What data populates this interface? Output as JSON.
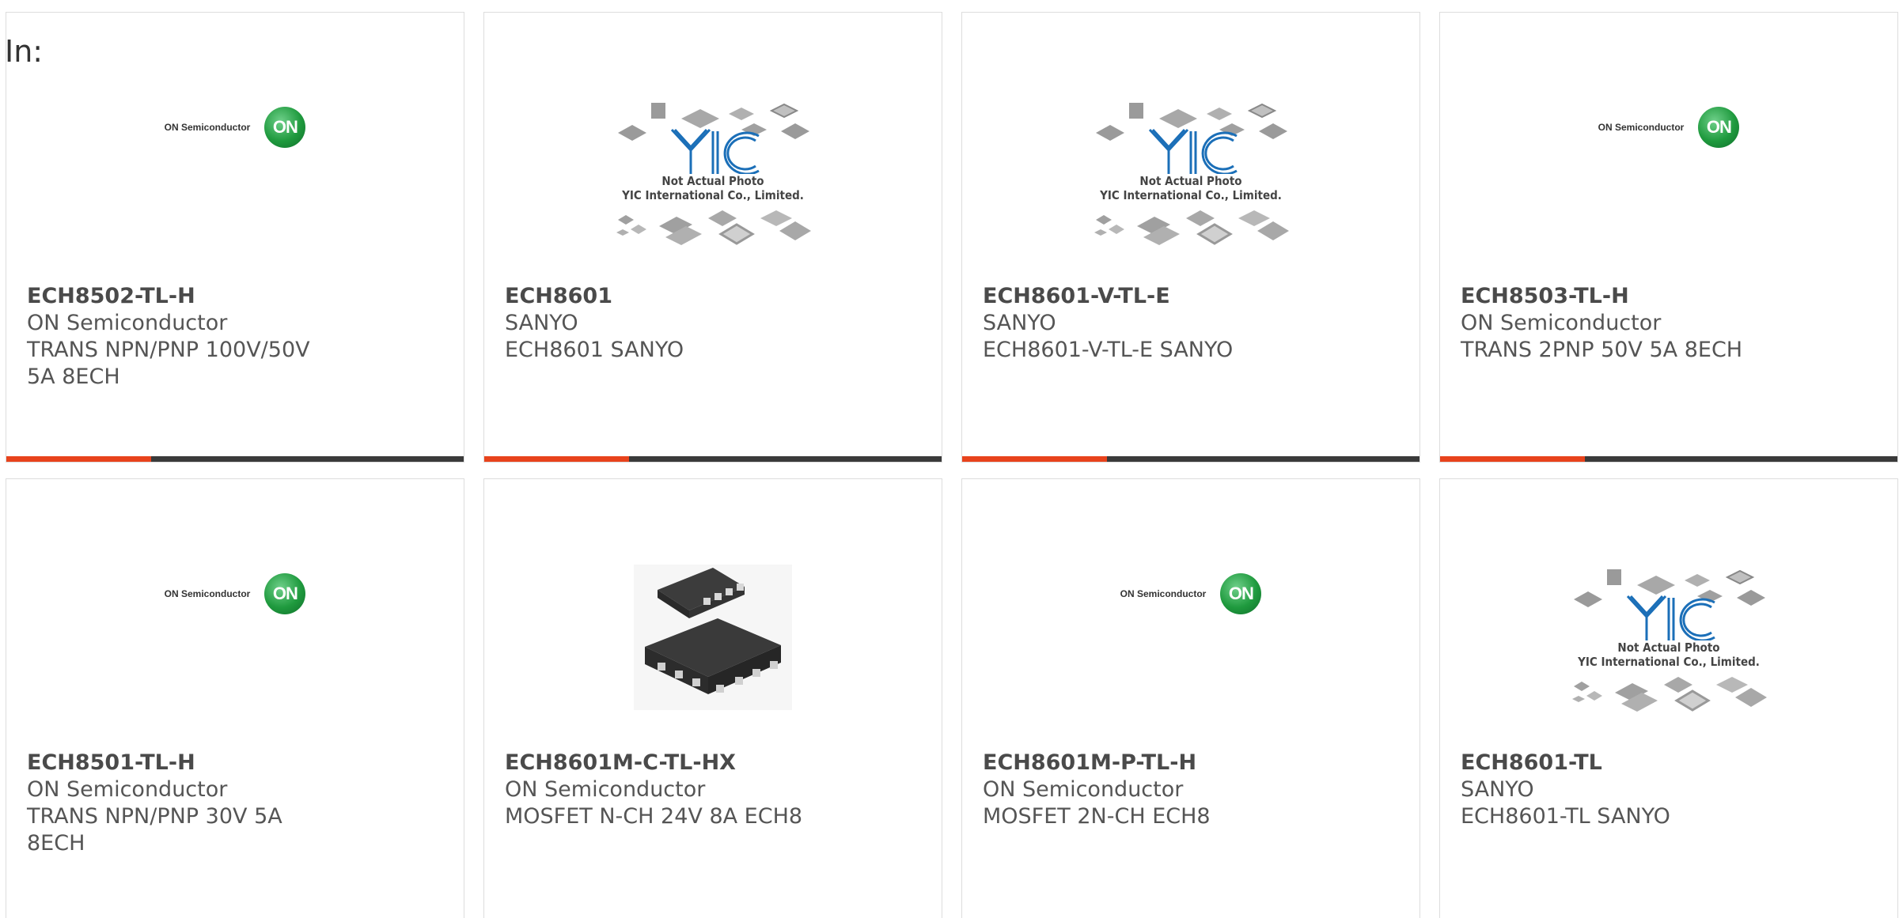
{
  "filter": {
    "label": "In:"
  },
  "logo_texts": {
    "on_semiconductor": "ON Semiconductor",
    "on_badge": "ON"
  },
  "placeholder": {
    "brand": "YIC",
    "line1": "Not Actual Photo",
    "line2": "YIC International Co., Limited."
  },
  "colors": {
    "accent": "#e8431c",
    "bar": "#3a3a3a",
    "on_green": "#1f9a3e",
    "yic_blue": "#1b6fb8"
  },
  "products": [
    {
      "part": "ECH8502-TL-H",
      "manufacturer": "ON Semiconductor",
      "description": "TRANS NPN/PNP 100V/50V 5A 8ECH",
      "image": "on-semiconductor-logo"
    },
    {
      "part": "ECH8601",
      "manufacturer": "SANYO",
      "description": "ECH8601 SANYO",
      "image": "yic-placeholder"
    },
    {
      "part": "ECH8601-V-TL-E",
      "manufacturer": "SANYO",
      "description": "ECH8601-V-TL-E SANYO",
      "image": "yic-placeholder"
    },
    {
      "part": "ECH8503-TL-H",
      "manufacturer": "ON Semiconductor",
      "description": "TRANS 2PNP 50V 5A 8ECH",
      "image": "on-semiconductor-logo"
    },
    {
      "part": "ECH8501-TL-H",
      "manufacturer": "ON Semiconductor",
      "description": "TRANS NPN/PNP 30V 5A 8ECH",
      "image": "on-semiconductor-logo"
    },
    {
      "part": "ECH8601M-C-TL-HX",
      "manufacturer": "ON Semiconductor",
      "description": "MOSFET N-CH 24V 8A ECH8",
      "image": "chip-package-photo"
    },
    {
      "part": "ECH8601M-P-TL-H",
      "manufacturer": "ON Semiconductor",
      "description": "MOSFET 2N-CH ECH8",
      "image": "on-semiconductor-logo"
    },
    {
      "part": "ECH8601-TL",
      "manufacturer": "SANYO",
      "description": "ECH8601-TL SANYO",
      "image": "yic-placeholder"
    }
  ]
}
